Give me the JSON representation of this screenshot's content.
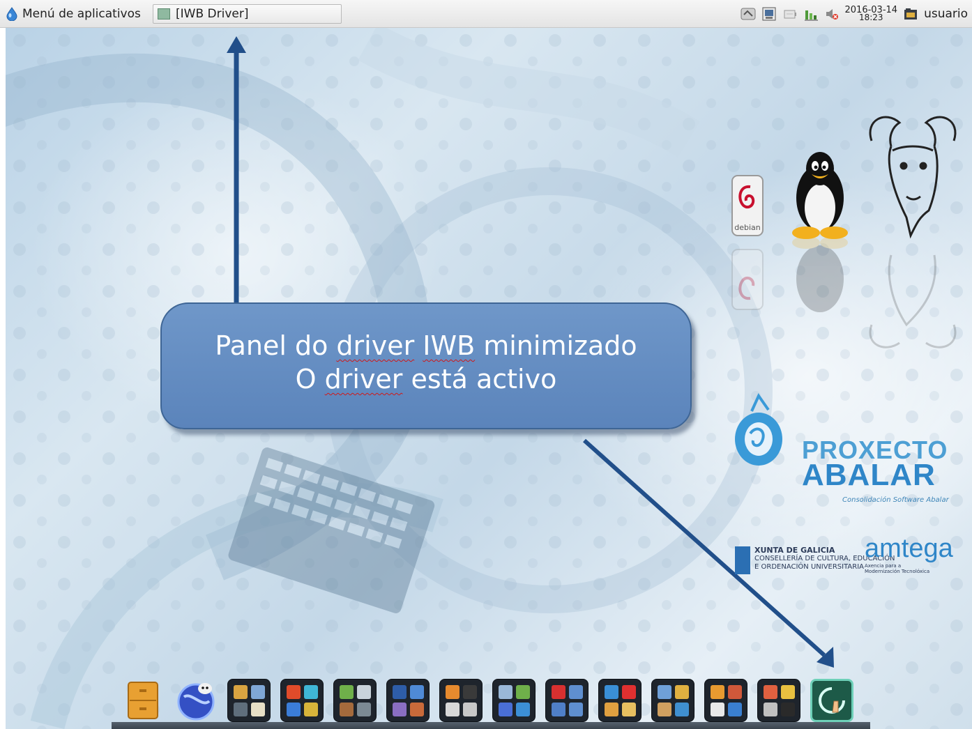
{
  "top_panel": {
    "menu_label": "Menú de aplicativos",
    "task_label": "[IWB Driver]",
    "clock_date": "2016-03-14",
    "clock_time": "18:23",
    "user_label": "usuario",
    "tray_icons": [
      "network-icon",
      "display-icon",
      "battery-icon",
      "graph-icon",
      "volume-muted-icon"
    ]
  },
  "callout": {
    "line1_a": "Panel do ",
    "line1_b": "driver",
    "line1_c": " ",
    "line1_d": "IWB",
    "line1_e": " minimizado",
    "line2_a": "O ",
    "line2_b": "driver",
    "line2_c": " está activo"
  },
  "branding": {
    "debian_label": "debian",
    "proxecto_line1": "PROXECTO",
    "proxecto_line2": "ABALAR",
    "proxecto_sub": "Consolidación Software Abalar",
    "xunta_line1": "XUNTA DE GALICIA",
    "xunta_line2": "CONSELLERÍA DE CULTURA, EDUCACIÓN",
    "xunta_line3": "E ORDENACIÓN UNIVERSITARIA",
    "amtega_name": "amtega",
    "amtega_sub1": "Axencia para a",
    "amtega_sub2": "Modernización Tecnolóxica"
  },
  "dock": {
    "items": [
      "file-cabinet-icon",
      "browser-icon",
      "accessories-group-icon",
      "graphics-group-icon",
      "science-group-icon",
      "office-group-icon",
      "multimedia-group-icon",
      "system-group-icon",
      "documents-group-icon",
      "internet-group-icon",
      "education-group-icon",
      "games-group-icon",
      "tools-group-icon",
      "iwb-driver-icon"
    ],
    "colors": {
      "accessories": [
        "#d9a441",
        "#7fa7d6",
        "#5f6e7c",
        "#e8e0c6"
      ],
      "graphics": [
        "#e04b2a",
        "#3fb6d6",
        "#3b7dd8",
        "#d8b43a"
      ],
      "science": [
        "#6fb04a",
        "#c9d3db",
        "#a46a3c",
        "#7c8a94"
      ],
      "office": [
        "#2e5da8",
        "#4f8ad6",
        "#8a6ec2",
        "#c96a3a"
      ],
      "multimedia": [
        "#e68a2e",
        "#3a3a3a",
        "#d8d8d8",
        "#c8c8c8"
      ],
      "system": [
        "#9ab8d8",
        "#6fb04a",
        "#4a6fd6",
        "#3c8fd6"
      ],
      "documents": [
        "#d83030",
        "#5f8fd0",
        "#4f7fc8",
        "#5f8fd0"
      ],
      "internet": [
        "#3a8fd6",
        "#e03030",
        "#e0a040",
        "#e8c060"
      ],
      "education": [
        "#6fa0d8",
        "#e0b040",
        "#d0a060",
        "#3f8fd0"
      ],
      "games": [
        "#e89a30",
        "#d0583a",
        "#e8e8e8",
        "#3a7fd0"
      ],
      "tools": [
        "#e06040",
        "#e8c040",
        "#c0c0c0",
        "#2a2a2a"
      ]
    }
  }
}
